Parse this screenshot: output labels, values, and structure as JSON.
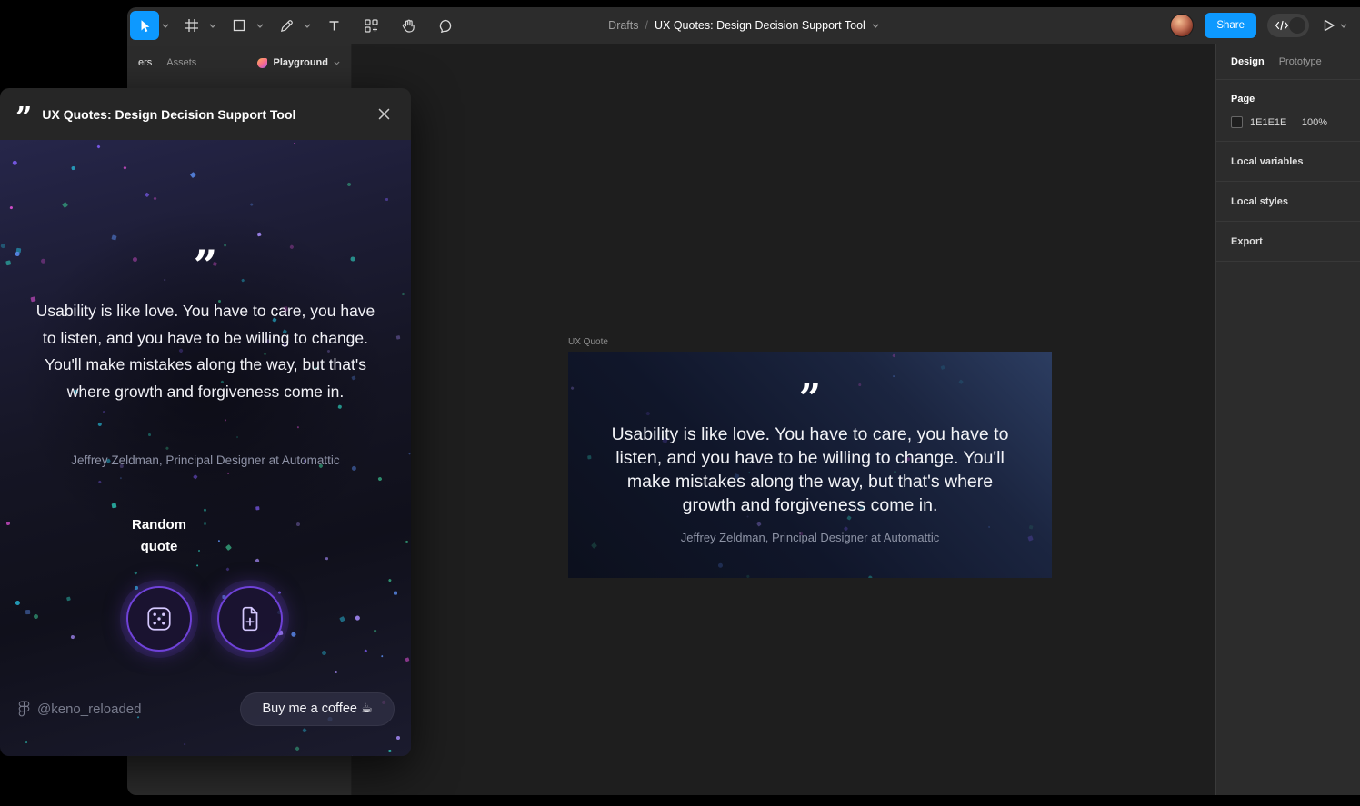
{
  "colors": {
    "accent_blue": "#0d99ff",
    "canvas_bg": "#1e1e1e",
    "panel_bg": "#2c2c2c",
    "purple_glow": "#6f42d8",
    "confetti": [
      "#2fd4c2",
      "#7d5cf0",
      "#d74fd0",
      "#39b98a",
      "#5b8def",
      "#a78bfa",
      "#27b3d2"
    ]
  },
  "toolbar": {
    "breadcrumb": {
      "root": "Drafts",
      "separator": "/",
      "title": "UX Quotes: Design Decision Support Tool"
    },
    "share_label": "Share",
    "tools": [
      "move",
      "frame",
      "shape",
      "pen",
      "text",
      "actions",
      "hand",
      "comment"
    ]
  },
  "left_panel": {
    "layers_tab": "ers",
    "assets_tab": "Assets",
    "page_name": "Playground"
  },
  "right_panel": {
    "design_tab": "Design",
    "prototype_tab": "Prototype",
    "page_label": "Page",
    "page_color": "1E1E1E",
    "page_opacity": "100%",
    "sections": [
      "Local variables",
      "Local styles",
      "Export"
    ]
  },
  "canvas": {
    "frame_label": "UX Quote"
  },
  "quote": {
    "glyph": "”",
    "text": "Usability is like love. You have to care, you have to listen, and you have to be willing to change. You'll make mistakes along the way, but that's where growth and forgiveness come in.",
    "attribution": "Jeffrey Zeldman, Principal Designer at Automattic"
  },
  "plugin": {
    "title": "UX Quotes: Design Decision Support Tool",
    "random_quote_label": "Random quote",
    "handle": "@keno_reloaded",
    "coffee_label": "Buy me a coffee ☕"
  }
}
